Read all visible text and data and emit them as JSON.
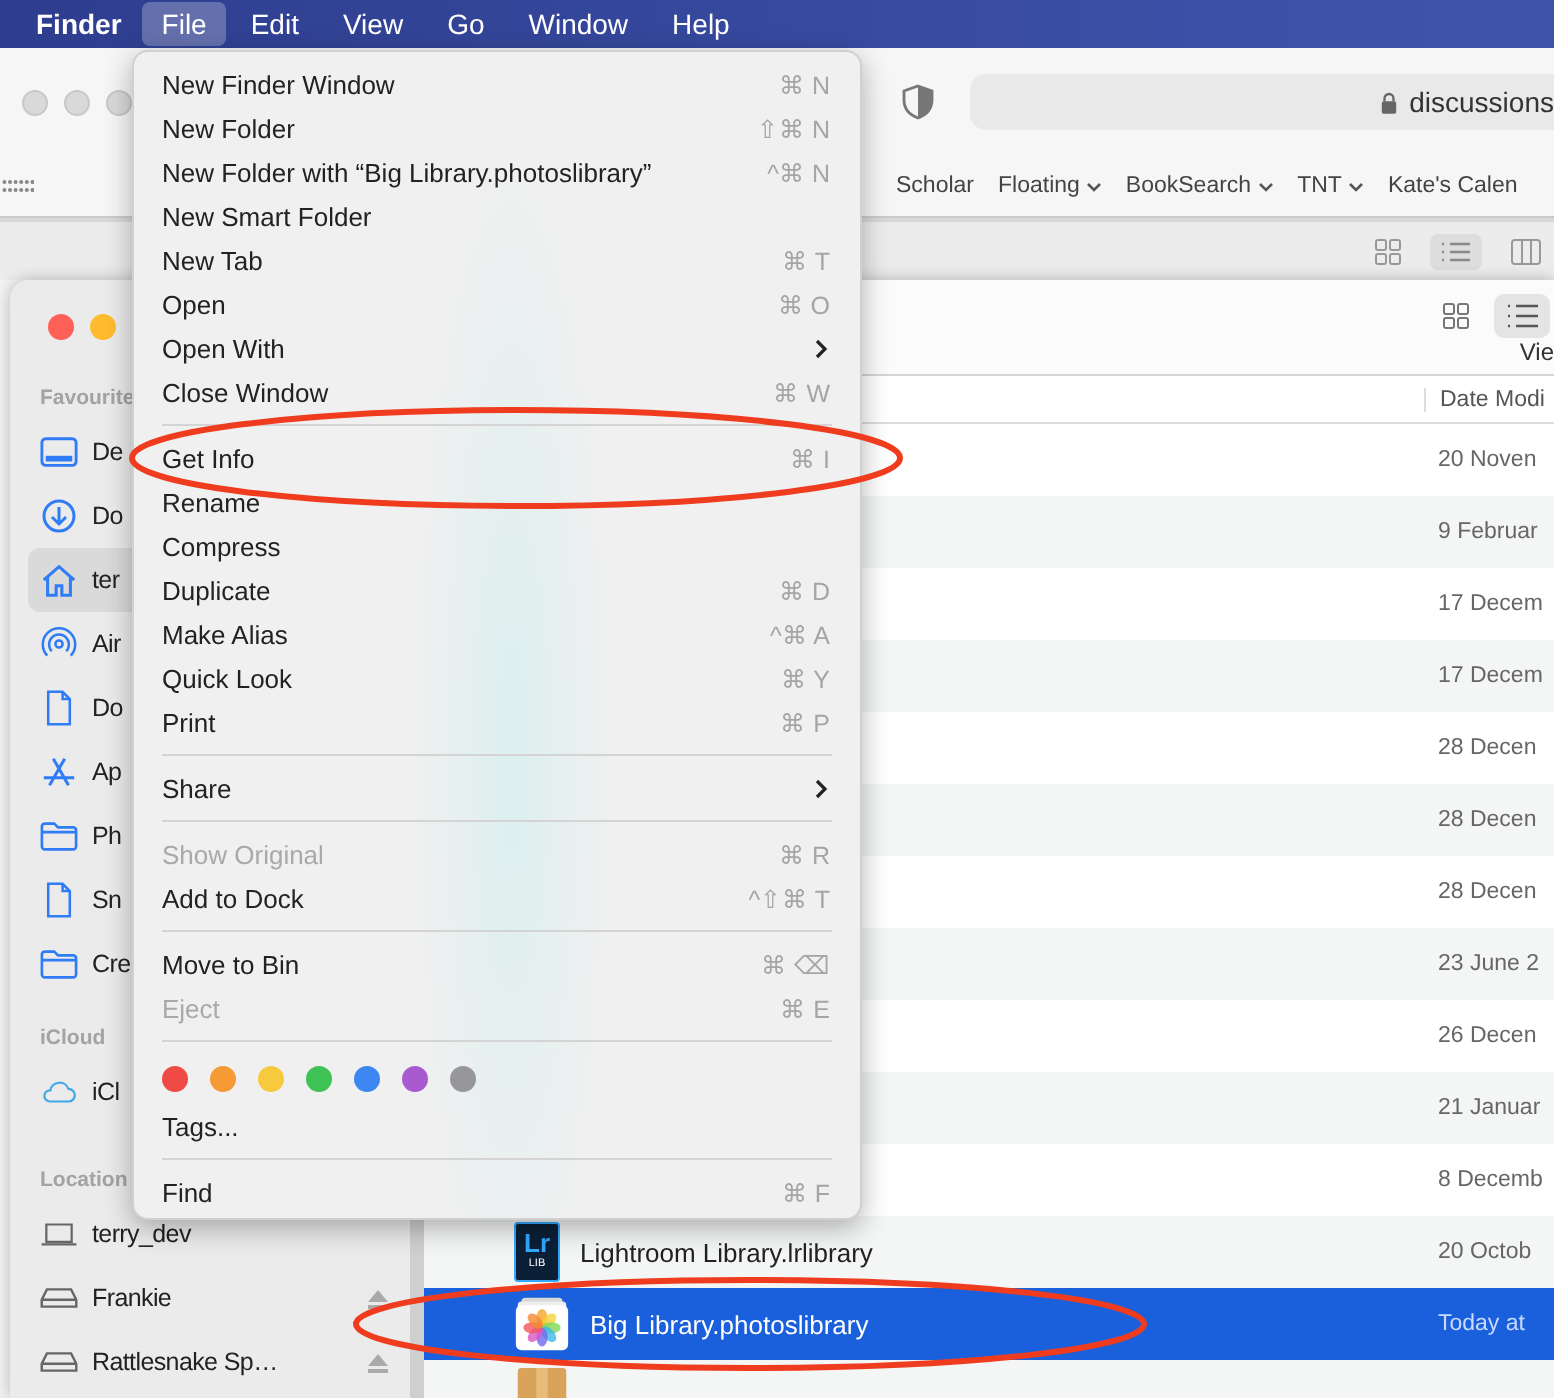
{
  "menubar": {
    "app": "Finder",
    "menus": [
      {
        "label": "File",
        "selected": true
      },
      {
        "label": "Edit",
        "selected": false
      },
      {
        "label": "View",
        "selected": false
      },
      {
        "label": "Go",
        "selected": false
      },
      {
        "label": "Window",
        "selected": false
      },
      {
        "label": "Help",
        "selected": false
      }
    ]
  },
  "browser": {
    "url": "discussions",
    "bookmarks": [
      {
        "label": "Scholar",
        "dropdown": false
      },
      {
        "label": "Floating",
        "dropdown": true
      },
      {
        "label": "BookSearch",
        "dropdown": true
      },
      {
        "label": "TNT",
        "dropdown": true
      },
      {
        "label": "Kate's Calen",
        "dropdown": false
      }
    ]
  },
  "finder": {
    "sidebar": [
      {
        "heading": "Favourite",
        "items": [
          {
            "label": "De",
            "kind": "desktop",
            "selected": false,
            "eject": false
          },
          {
            "label": "Do",
            "kind": "download",
            "selected": false,
            "eject": false
          },
          {
            "label": "ter",
            "kind": "home",
            "selected": true,
            "eject": false
          },
          {
            "label": "Air",
            "kind": "airdrop",
            "selected": false,
            "eject": false
          },
          {
            "label": "Do",
            "kind": "document",
            "selected": false,
            "eject": false
          },
          {
            "label": "Ap",
            "kind": "apps",
            "selected": false,
            "eject": false
          },
          {
            "label": "Ph",
            "kind": "folder",
            "selected": false,
            "eject": false
          },
          {
            "label": "Sn",
            "kind": "document",
            "selected": false,
            "eject": false
          },
          {
            "label": "Cre",
            "kind": "folder",
            "selected": false,
            "eject": false
          }
        ]
      },
      {
        "heading": "iCloud",
        "items": [
          {
            "label": "iCl",
            "kind": "cloud",
            "selected": false,
            "eject": false
          }
        ]
      },
      {
        "heading": "Location",
        "items": [
          {
            "label": "terry_dev",
            "kind": "laptop",
            "selected": false,
            "eject": false
          },
          {
            "label": "Frankie",
            "kind": "drive",
            "selected": false,
            "eject": true
          },
          {
            "label": "Rattlesnake Sp…",
            "kind": "drive",
            "selected": false,
            "eject": true
          }
        ]
      }
    ],
    "view_label": "Vie",
    "column_header": "Date Modi",
    "rows": [
      {
        "date": "20 Noven",
        "selected": false
      },
      {
        "date": "9 Februar",
        "selected": false
      },
      {
        "date": "17 Decem",
        "selected": false
      },
      {
        "date": "17 Decem",
        "selected": false
      },
      {
        "date": "28 Decen",
        "selected": false
      },
      {
        "date": "28 Decen",
        "selected": false
      },
      {
        "date": "28 Decen",
        "selected": false
      },
      {
        "date": "23 June 2",
        "selected": false
      },
      {
        "date": "26 Decen",
        "selected": false
      },
      {
        "date": "21 Januar",
        "selected": false
      },
      {
        "date": "8 Decemb",
        "selected": false
      },
      {
        "name": "Lightroom Library.lrlibrary",
        "date": "20 Octob",
        "selected": false,
        "kind": "lightroom",
        "icon_label": "Lr",
        "icon_sublabel": "LIB"
      },
      {
        "name": "Big Library.photoslibrary",
        "date": "Today at",
        "selected": true,
        "kind": "photos"
      },
      {
        "selected": false,
        "kind": "zip"
      }
    ]
  },
  "menu": {
    "items": [
      {
        "kind": "item",
        "label": "New Finder Window",
        "shortcut": "⌘ N",
        "disabled": false,
        "submenu": false
      },
      {
        "kind": "item",
        "label": "New Folder",
        "shortcut": "⇧⌘ N",
        "disabled": false,
        "submenu": false
      },
      {
        "kind": "item",
        "label": "New Folder with “Big Library.photoslibrary”",
        "shortcut": "^⌘ N",
        "disabled": false,
        "submenu": false
      },
      {
        "kind": "item",
        "label": "New Smart Folder",
        "disabled": false,
        "submenu": false
      },
      {
        "kind": "item",
        "label": "New Tab",
        "shortcut": "⌘ T",
        "disabled": false,
        "submenu": false
      },
      {
        "kind": "item",
        "label": "Open",
        "shortcut": "⌘ O",
        "disabled": false,
        "submenu": false
      },
      {
        "kind": "item",
        "label": "Open With",
        "disabled": false,
        "submenu": true
      },
      {
        "kind": "item",
        "label": "Close Window",
        "shortcut": "⌘ W",
        "disabled": false,
        "submenu": false
      },
      {
        "kind": "separator"
      },
      {
        "kind": "item",
        "label": "Get Info",
        "shortcut": "⌘ I",
        "disabled": false,
        "submenu": false
      },
      {
        "kind": "item",
        "label": "Rename",
        "disabled": false,
        "submenu": false
      },
      {
        "kind": "item",
        "label": "Compress",
        "disabled": false,
        "submenu": false
      },
      {
        "kind": "item",
        "label": "Duplicate",
        "shortcut": "⌘ D",
        "disabled": false,
        "submenu": false
      },
      {
        "kind": "item",
        "label": "Make Alias",
        "shortcut": "^⌘ A",
        "disabled": false,
        "submenu": false
      },
      {
        "kind": "item",
        "label": "Quick Look",
        "shortcut": "⌘ Y",
        "disabled": false,
        "submenu": false
      },
      {
        "kind": "item",
        "label": "Print",
        "shortcut": "⌘ P",
        "disabled": false,
        "submenu": false
      },
      {
        "kind": "separator"
      },
      {
        "kind": "item",
        "label": "Share",
        "disabled": false,
        "submenu": true
      },
      {
        "kind": "separator"
      },
      {
        "kind": "item",
        "label": "Show Original",
        "shortcut": "⌘ R",
        "disabled": true,
        "submenu": false
      },
      {
        "kind": "item",
        "label": "Add to Dock",
        "shortcut": "^⇧⌘ T",
        "disabled": false,
        "submenu": false
      },
      {
        "kind": "separator"
      },
      {
        "kind": "item",
        "label": "Move to Bin",
        "shortcut": "⌘ ⌫",
        "disabled": false,
        "submenu": false
      },
      {
        "kind": "item",
        "label": "Eject",
        "shortcut": "⌘ E",
        "disabled": true,
        "submenu": false
      },
      {
        "kind": "separator"
      },
      {
        "kind": "tags",
        "tags": [
          {
            "color": "#f04a47"
          },
          {
            "color": "#f59a34"
          },
          {
            "color": "#f6ca3c"
          },
          {
            "color": "#3fc254"
          },
          {
            "color": "#3c87f1"
          },
          {
            "color": "#a85bcf"
          },
          {
            "color": "#97979a"
          }
        ]
      },
      {
        "kind": "item",
        "label": "Tags...",
        "disabled": false,
        "submenu": false
      },
      {
        "kind": "separator"
      },
      {
        "kind": "item",
        "label": "Find",
        "shortcut": "⌘ F",
        "disabled": false,
        "submenu": false
      }
    ]
  }
}
